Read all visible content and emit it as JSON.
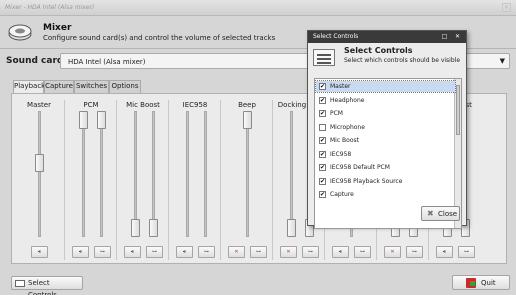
{
  "window": {
    "title": "Mixer - HDA Intel (Alsa mixer)",
    "close_glyph": "✕"
  },
  "header": {
    "title": "Mixer",
    "subtitle": "Configure sound card(s) and control the volume of selected tracks",
    "icon": "speaker-icon"
  },
  "sound_card": {
    "label": "Sound card:",
    "value": "HDA Intel (Alsa mixer)"
  },
  "tabs": [
    "Playback",
    "Capture",
    "Switches",
    "Options"
  ],
  "active_tab": "Playback",
  "channels": [
    {
      "label": "Master",
      "levels": [
        0.6
      ],
      "button_icons": [
        "speaker-icon"
      ]
    },
    {
      "label": "PCM",
      "levels": [
        1.0,
        1.0
      ],
      "button_icons": [
        "speaker-icon",
        "link-icon"
      ]
    },
    {
      "label": "Mic Boost",
      "levels": [
        0.0,
        0.0
      ],
      "button_icons": [
        "speaker-icon",
        "link-icon"
      ]
    },
    {
      "label": "IEC958",
      "levels": [],
      "button_icons": [
        "speaker-icon",
        "link-icon"
      ]
    },
    {
      "label": "Beep",
      "levels": [
        1.0
      ],
      "button_icons": [
        "muted-icon",
        "link-icon"
      ]
    },
    {
      "label": "Docking Mic",
      "levels": [
        0.0,
        0.0
      ],
      "button_icons": [
        "muted-icon",
        "link-icon"
      ]
    },
    {
      "label": "",
      "levels": [
        1.0
      ],
      "button_icons": [
        "speaker-icon",
        "link-icon"
      ]
    },
    {
      "label": "",
      "levels": [
        0.0,
        0.0
      ],
      "button_icons": [
        "muted-icon",
        "link-icon"
      ]
    },
    {
      "label": "Mic Boost",
      "levels": [
        0.0,
        0.0
      ],
      "button_icons": [
        "speaker-icon",
        "link-icon"
      ]
    }
  ],
  "buttons": {
    "select_controls": "Select Controls...",
    "quit": "Quit"
  },
  "dialog": {
    "bar_title": "Select Controls",
    "title": "Select Controls",
    "subtitle": "Select which controls should be visible",
    "close_label": "Close",
    "items": [
      {
        "label": "Master",
        "checked": true,
        "selected": true
      },
      {
        "label": "Headphone",
        "checked": true,
        "selected": false
      },
      {
        "label": "PCM",
        "checked": true,
        "selected": false
      },
      {
        "label": "Microphone",
        "checked": false,
        "selected": false
      },
      {
        "label": "Mic Boost",
        "checked": true,
        "selected": false
      },
      {
        "label": "IEC958",
        "checked": true,
        "selected": false
      },
      {
        "label": "IEC958 Default PCM",
        "checked": true,
        "selected": false
      },
      {
        "label": "IEC958 Playback Source",
        "checked": true,
        "selected": false
      },
      {
        "label": "Capture",
        "checked": true,
        "selected": false
      }
    ]
  }
}
